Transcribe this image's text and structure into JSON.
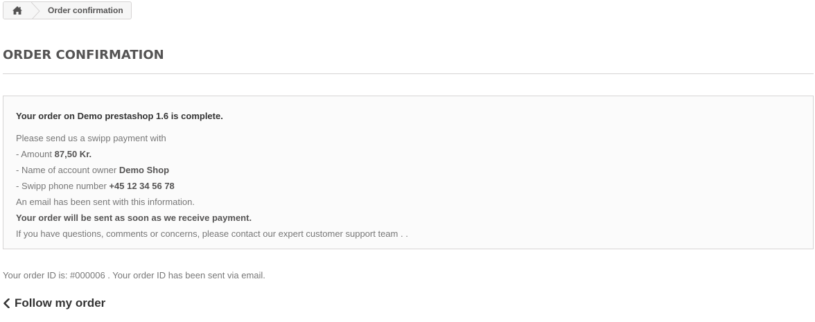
{
  "breadcrumb": {
    "home_icon": "home-icon",
    "current": "Order confirmation"
  },
  "heading": "ORDER CONFIRMATION",
  "confirmation": {
    "lead": "Your order on Demo prestashop 1.6 is complete.",
    "intro": "Please send us a swipp payment with",
    "amount_prefix": "- Amount",
    "amount_value": "87,50 Kr.",
    "owner_prefix": "- Name of account owner",
    "owner_value": "Demo Shop",
    "phone_prefix": "- Swipp phone number",
    "phone_value": "+45 12 34 56 78",
    "email_note": "An email has been sent with this information.",
    "payment_note": "Your order will be sent as soon as we receive payment.",
    "support_prefix": "If you have questions, comments or concerns, please contact our",
    "support_link": "expert customer support team",
    "support_suffix": ". ."
  },
  "order_id_line": "Your order ID is: #000006 . Your order ID has been sent via email.",
  "follow_link": {
    "label": "Follow my order",
    "icon": "chevron-left-icon"
  }
}
